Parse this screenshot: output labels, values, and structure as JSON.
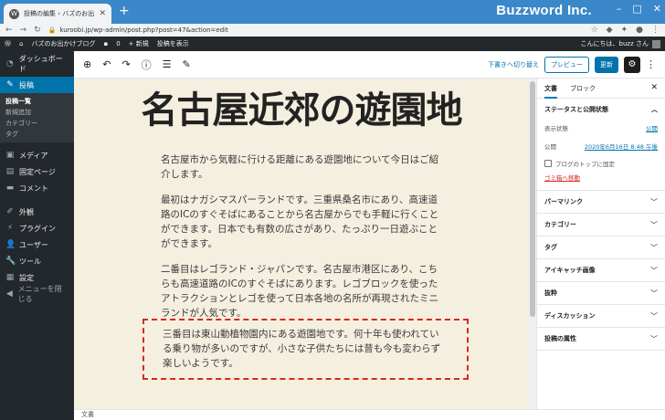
{
  "browser": {
    "tab_title": "投稿の編集 ‹ バズのお出かけブログ — Wo...",
    "tab_favicon": "wordpress-icon",
    "url": "kuroobi.jp/wp-admin/post.php?post=47&action=edit",
    "brand": "Buzzword Inc."
  },
  "adminbar": {
    "site_name": "バズのお出かけブログ",
    "comments_count": "0",
    "new_label": "新規",
    "view_post": "投稿を表示",
    "greeting": "こんにちは、buzz さん"
  },
  "sidebar": {
    "dashboard": "ダッシュボード",
    "posts": "投稿",
    "posts_sub": [
      "投稿一覧",
      "新規追加",
      "カテゴリー",
      "タグ"
    ],
    "media": "メディア",
    "pages": "固定ページ",
    "comments": "コメント",
    "appearance": "外観",
    "plugins": "プラグイン",
    "users": "ユーザー",
    "tools": "ツール",
    "settings": "設定",
    "collapse": "メニューを閉じる"
  },
  "toolbar": {
    "save_draft": "下書きへ切り替え",
    "preview": "プレビュー",
    "update": "更新"
  },
  "post": {
    "title": "名古屋近郊の遊園地",
    "paragraphs": [
      "名古屋市から気軽に行ける距離にある遊園地について今日はご紹介します。",
      "最初はナガシマスパーランドです。三重県桑名市にあり、高速道路のICのすぐそばにあることから名古屋からでも手軽に行くことができます。日本でも有数の広さがあり、たっぷり一日遊ぶことができます。",
      "二番目はレゴランド・ジャパンです。名古屋市港区にあり、こちらも高速道路のICのすぐそばにあります。レゴブロックを使ったアトラクションとレゴを使って日本各地の名所が再現されたミニランドが人気です。",
      "三番目は東山動植物園内にある遊園地です。何十年も使われている乗り物が多いのですが、小さな子供たちには昔も今も変わらず楽しいようです。"
    ]
  },
  "panel": {
    "tab_document": "文書",
    "tab_block": "ブロック",
    "status_title": "ステータスと公開状態",
    "visibility_label": "表示状態",
    "visibility_value": "公開",
    "publish_label": "公開",
    "publish_value": "2020年6月16日 8:48 午後",
    "sticky_label": "ブログのトップに固定",
    "trash": "ゴミ箱へ移動",
    "sections": [
      "パーマリンク",
      "カテゴリー",
      "タグ",
      "アイキャッチ画像",
      "抜粋",
      "ディスカッション",
      "投稿の属性"
    ]
  },
  "footer": {
    "breadcrumb": "文書"
  },
  "colors": {
    "accent": "#0073aa",
    "admin_dark": "#23282d",
    "highlight_border": "#d52a1e",
    "canvas_bg": "#f5efe0"
  }
}
